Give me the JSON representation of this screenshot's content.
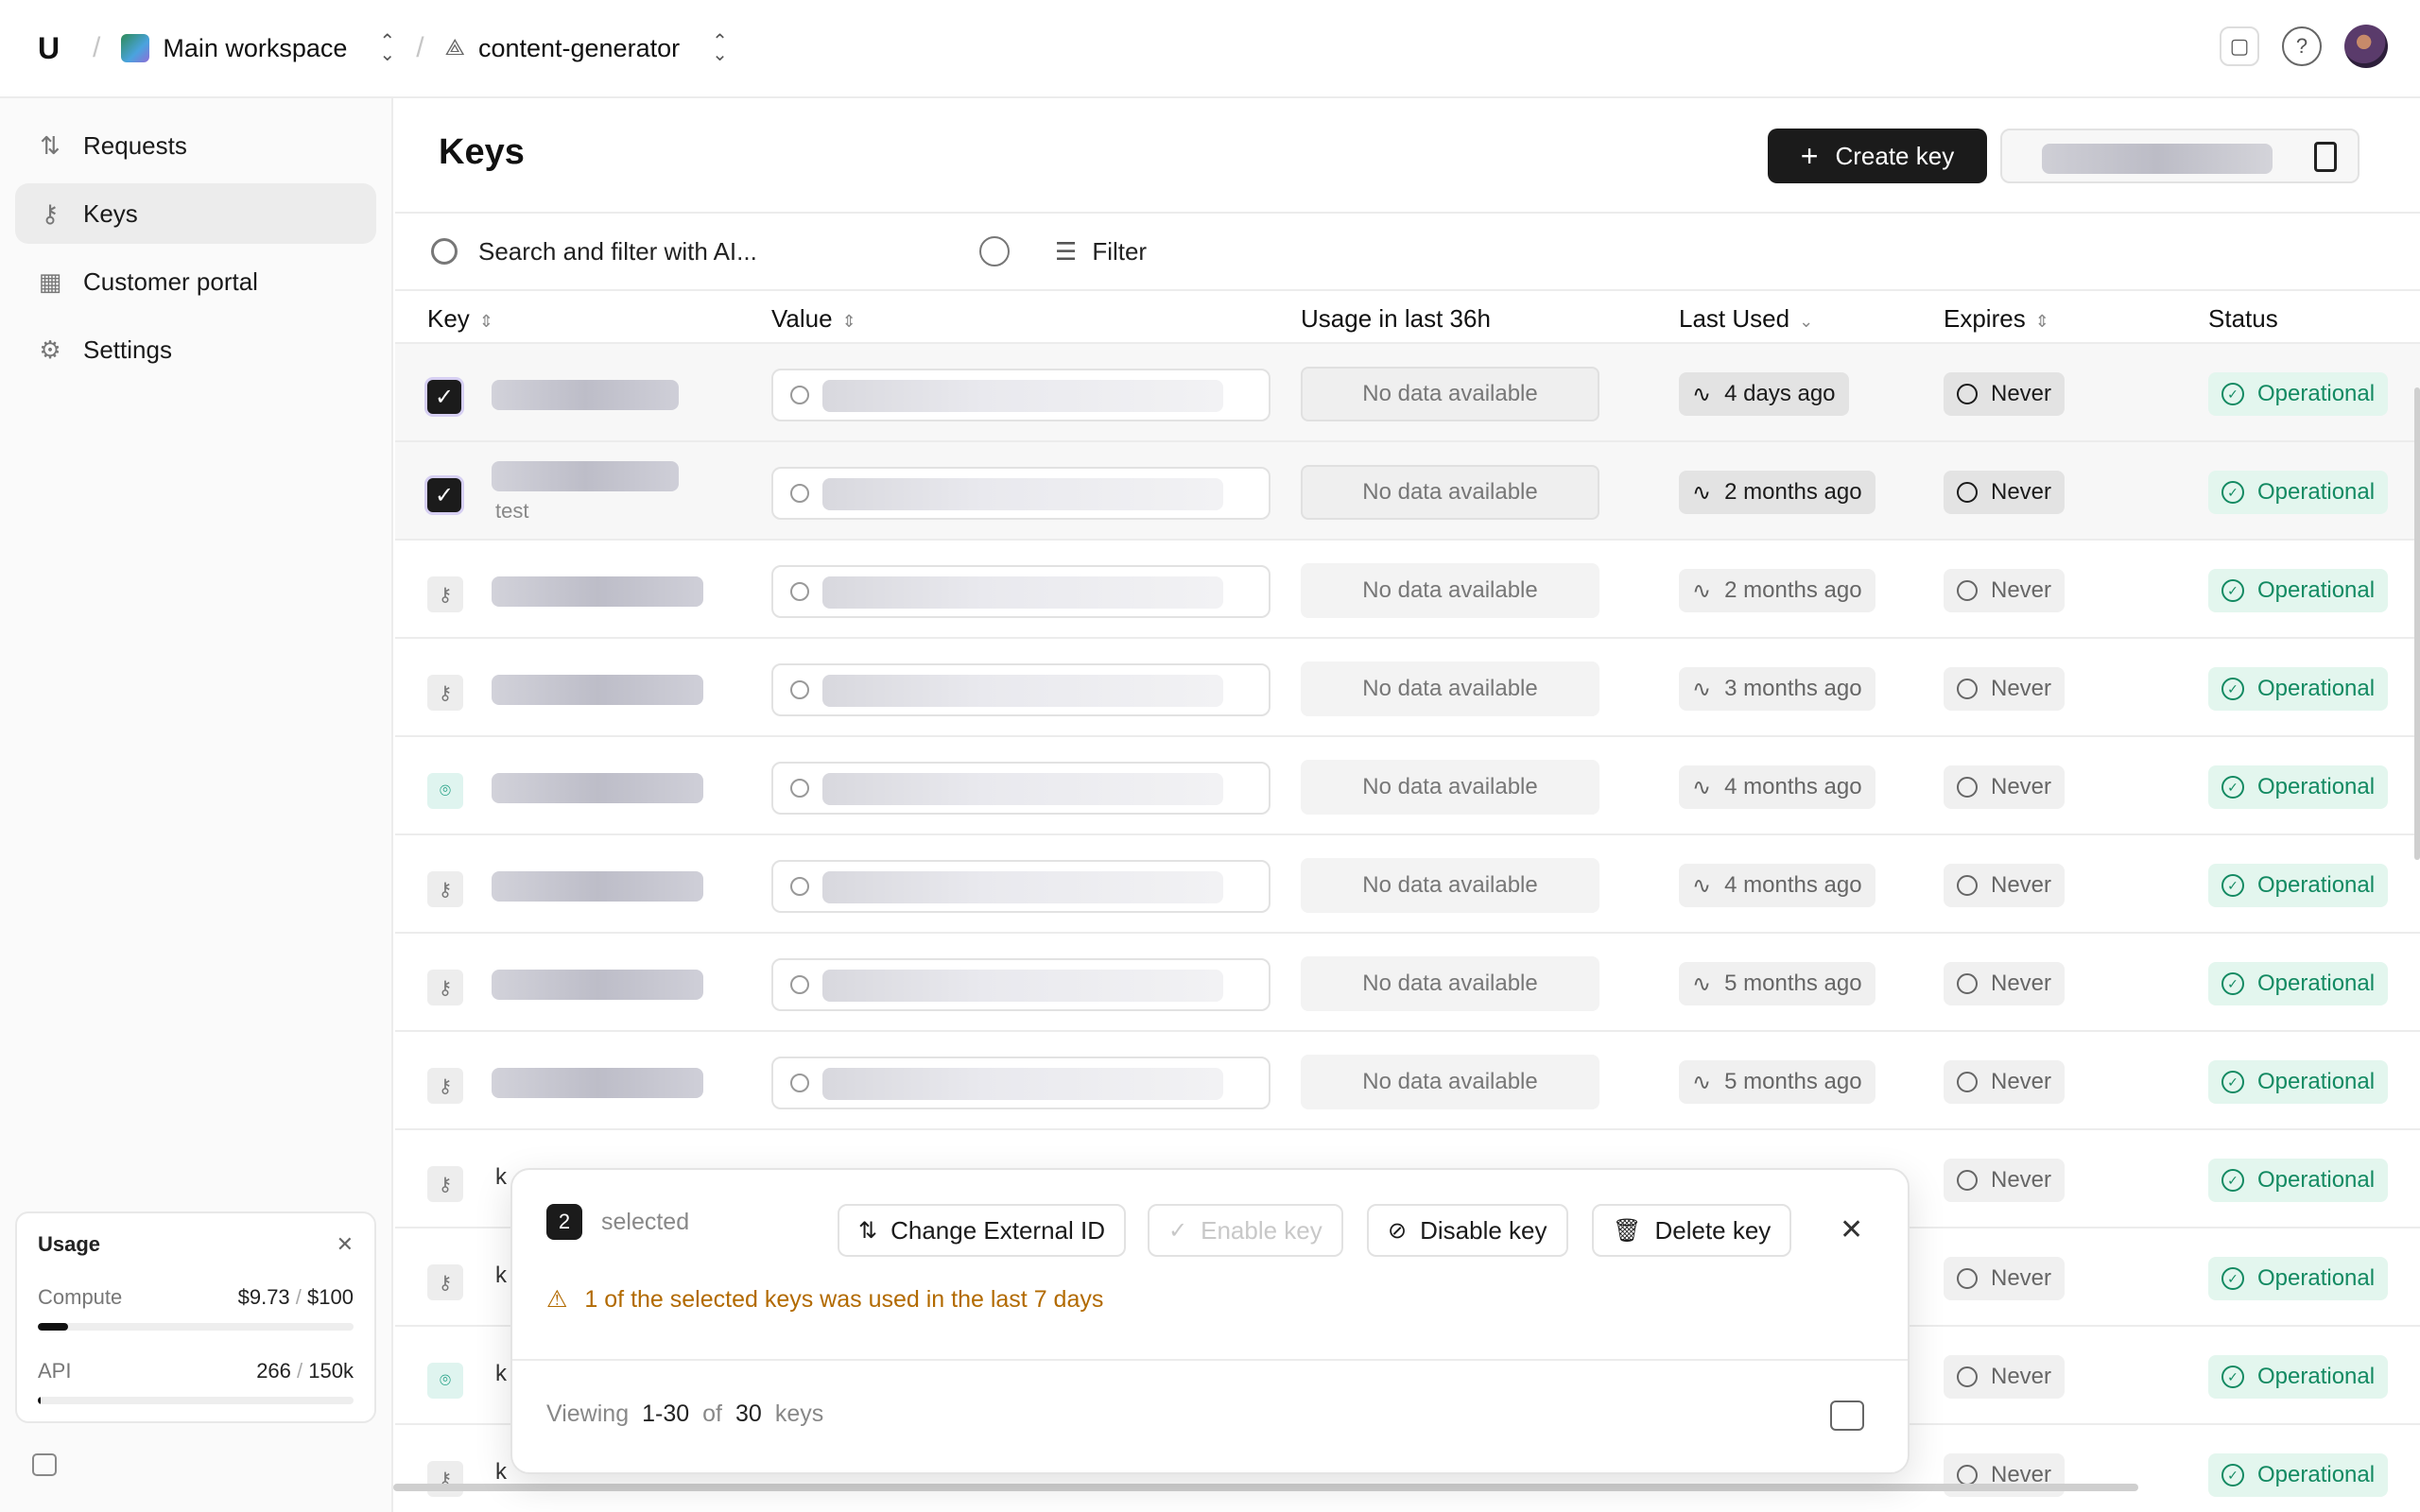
{
  "topbar": {
    "logo": "U",
    "workspace": "Main workspace",
    "project": "content-generator"
  },
  "sidebar": {
    "items": [
      {
        "label": "Requests",
        "icon": "arrows-updown-icon"
      },
      {
        "label": "Keys",
        "icon": "key-icon"
      },
      {
        "label": "Customer portal",
        "icon": "layout-icon"
      },
      {
        "label": "Settings",
        "icon": "gear-icon"
      }
    ],
    "usage": {
      "title": "Usage",
      "compute_label": "Compute",
      "compute_used": "$9.73",
      "compute_sep": "/",
      "compute_limit": "$100",
      "compute_fraction": 0.0973,
      "api_label": "API",
      "api_used": "266",
      "api_sep": "/",
      "api_limit": "150k",
      "api_fraction": 0.0018
    }
  },
  "main": {
    "title": "Keys",
    "create_label": "Create key",
    "search_placeholder": "Search and filter with AI...",
    "filter_label": "Filter",
    "columns": {
      "key": "Key",
      "value": "Value",
      "usage": "Usage in last 36h",
      "last_used": "Last Used",
      "expires": "Expires",
      "status": "Status"
    },
    "rows": [
      {
        "selected": true,
        "icon": "check",
        "sub": "",
        "usage": "No data available",
        "last_used": "4 days ago",
        "expires": "Never",
        "status": "Operational"
      },
      {
        "selected": true,
        "icon": "check",
        "sub": "test",
        "usage": "No data available",
        "last_used": "2 months ago",
        "expires": "Never",
        "status": "Operational"
      },
      {
        "selected": false,
        "icon": "key",
        "sub": "",
        "usage": "No data available",
        "last_used": "2 months ago",
        "expires": "Never",
        "status": "Operational"
      },
      {
        "selected": false,
        "icon": "key",
        "sub": "",
        "usage": "No data available",
        "last_used": "3 months ago",
        "expires": "Never",
        "status": "Operational"
      },
      {
        "selected": false,
        "icon": "scan",
        "sub": "",
        "usage": "No data available",
        "last_used": "4 months ago",
        "expires": "Never",
        "status": "Operational"
      },
      {
        "selected": false,
        "icon": "key",
        "sub": "",
        "usage": "No data available",
        "last_used": "4 months ago",
        "expires": "Never",
        "status": "Operational"
      },
      {
        "selected": false,
        "icon": "key",
        "sub": "",
        "usage": "No data available",
        "last_used": "5 months ago",
        "expires": "Never",
        "status": "Operational"
      },
      {
        "selected": false,
        "icon": "key",
        "sub": "",
        "usage": "No data available",
        "last_used": "5 months ago",
        "expires": "Never",
        "status": "Operational"
      },
      {
        "selected": false,
        "icon": "key",
        "key_text": "k",
        "expires": "Never",
        "status": "Operational"
      },
      {
        "selected": false,
        "icon": "key",
        "key_text": "k",
        "expires": "Never",
        "status": "Operational"
      },
      {
        "selected": false,
        "icon": "scan",
        "key_text": "k",
        "expires": "Never",
        "status": "Operational"
      },
      {
        "selected": false,
        "icon": "key",
        "key_text": "k",
        "expires": "Never",
        "status": "Operational"
      }
    ]
  },
  "selection_bar": {
    "count": "2",
    "selected_label": "selected",
    "change_external_id": "Change External ID",
    "enable_key": "Enable key",
    "disable_key": "Disable key",
    "delete_key": "Delete key",
    "warning": "1 of the selected keys was used in the last 7 days",
    "viewing_label": "Viewing",
    "range": "1-30",
    "of_label": "of",
    "total": "30",
    "keys_label": "keys"
  }
}
